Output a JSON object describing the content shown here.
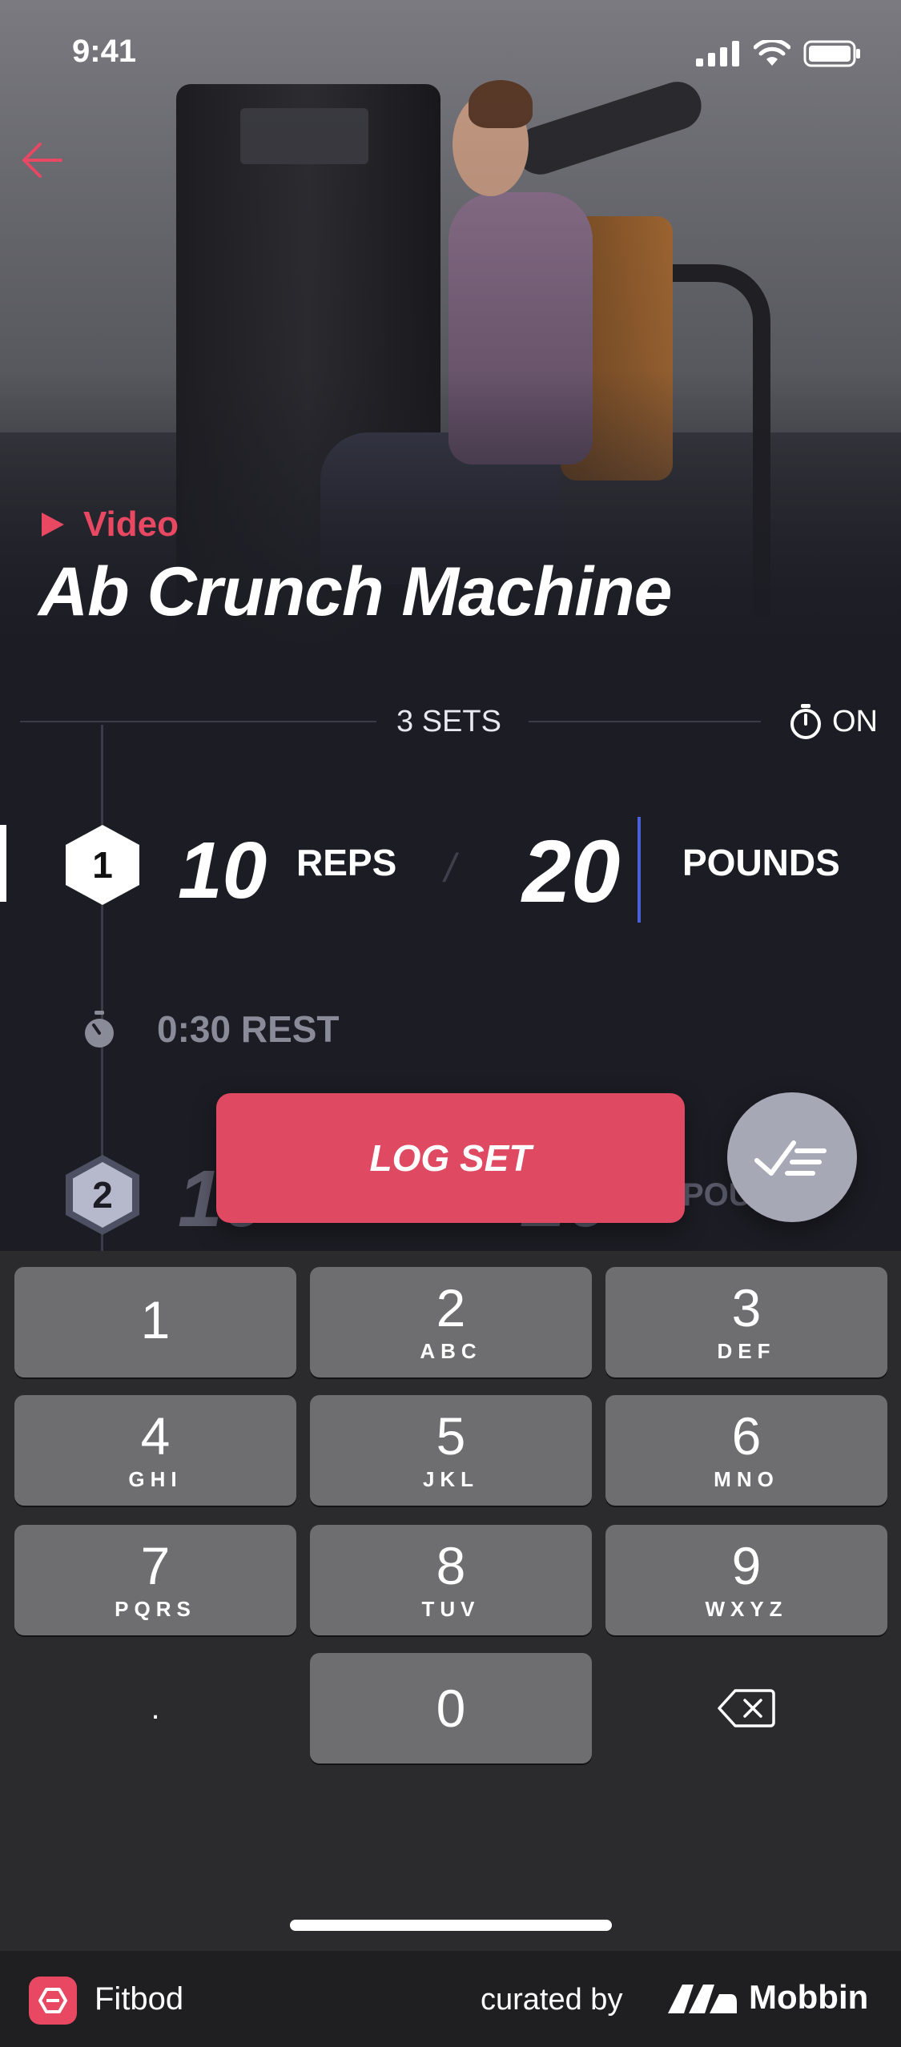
{
  "status_bar": {
    "time": "9:41"
  },
  "exercise": {
    "video_label": "Video",
    "title": "Ab Crunch Machine"
  },
  "sets": {
    "label": "3 SETS",
    "timer_label": "ON"
  },
  "set1": {
    "number": "1",
    "reps_value": "10",
    "reps_unit": "REPS",
    "divider": "/",
    "weight_value": "20",
    "weight_unit": "POUNDS"
  },
  "rest": {
    "label": "0:30 REST"
  },
  "set2": {
    "number": "2",
    "reps_value": "10",
    "weight_value": "20",
    "weight_unit": "POU"
  },
  "actions": {
    "log_set": "LOG SET"
  },
  "keypad": {
    "keys": [
      {
        "num": "1",
        "letters": ""
      },
      {
        "num": "2",
        "letters": "ABC"
      },
      {
        "num": "3",
        "letters": "DEF"
      },
      {
        "num": "4",
        "letters": "GHI"
      },
      {
        "num": "5",
        "letters": "JKL"
      },
      {
        "num": "6",
        "letters": "MNO"
      },
      {
        "num": "7",
        "letters": "PQRS"
      },
      {
        "num": "8",
        "letters": "TUV"
      },
      {
        "num": "9",
        "letters": "WXYZ"
      },
      {
        "num": "0",
        "letters": ""
      }
    ],
    "decimal": "."
  },
  "footer": {
    "app_name": "Fitbod",
    "curated_by": "curated by",
    "brand": "Mobbin"
  },
  "colors": {
    "accent": "#df4a62",
    "background": "#1c1c24",
    "keypad_bg": "#2b2b2d",
    "key_bg": "#6e6e70",
    "cursor": "#4860d8"
  }
}
